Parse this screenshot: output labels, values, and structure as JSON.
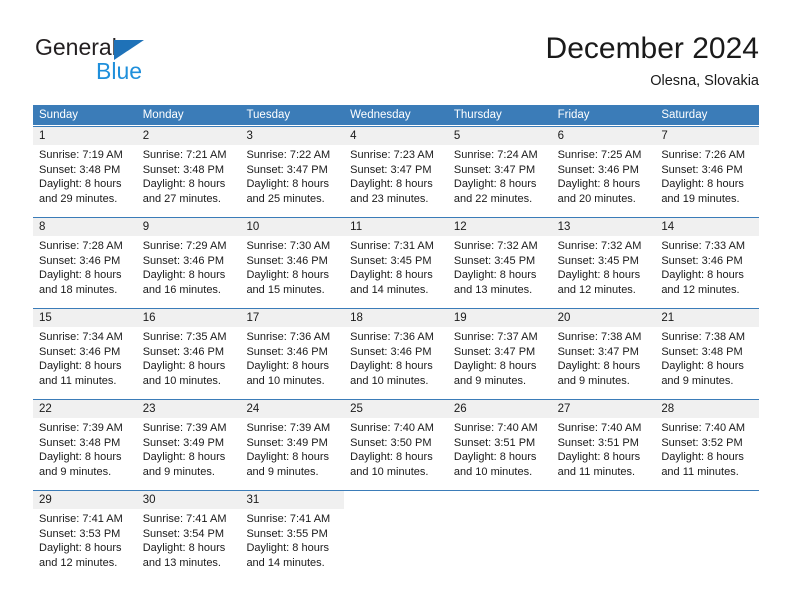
{
  "logo": {
    "word_top": "General",
    "word_bottom": "Blue",
    "triangle_color": "#1f72b8",
    "bottom_color": "#1f8fdb"
  },
  "header": {
    "title": "December 2024",
    "subtitle": "Olesna, Slovakia"
  },
  "theme": {
    "header_blue": "#3b7cb8",
    "daynum_band": "#f0f0f0",
    "text": "#1a1a1a"
  },
  "weekdays": [
    "Sunday",
    "Monday",
    "Tuesday",
    "Wednesday",
    "Thursday",
    "Friday",
    "Saturday"
  ],
  "weeks": [
    [
      {
        "day": "1",
        "sunrise": "Sunrise: 7:19 AM",
        "sunset": "Sunset: 3:48 PM",
        "daylight1": "Daylight: 8 hours",
        "daylight2": "and 29 minutes."
      },
      {
        "day": "2",
        "sunrise": "Sunrise: 7:21 AM",
        "sunset": "Sunset: 3:48 PM",
        "daylight1": "Daylight: 8 hours",
        "daylight2": "and 27 minutes."
      },
      {
        "day": "3",
        "sunrise": "Sunrise: 7:22 AM",
        "sunset": "Sunset: 3:47 PM",
        "daylight1": "Daylight: 8 hours",
        "daylight2": "and 25 minutes."
      },
      {
        "day": "4",
        "sunrise": "Sunrise: 7:23 AM",
        "sunset": "Sunset: 3:47 PM",
        "daylight1": "Daylight: 8 hours",
        "daylight2": "and 23 minutes."
      },
      {
        "day": "5",
        "sunrise": "Sunrise: 7:24 AM",
        "sunset": "Sunset: 3:47 PM",
        "daylight1": "Daylight: 8 hours",
        "daylight2": "and 22 minutes."
      },
      {
        "day": "6",
        "sunrise": "Sunrise: 7:25 AM",
        "sunset": "Sunset: 3:46 PM",
        "daylight1": "Daylight: 8 hours",
        "daylight2": "and 20 minutes."
      },
      {
        "day": "7",
        "sunrise": "Sunrise: 7:26 AM",
        "sunset": "Sunset: 3:46 PM",
        "daylight1": "Daylight: 8 hours",
        "daylight2": "and 19 minutes."
      }
    ],
    [
      {
        "day": "8",
        "sunrise": "Sunrise: 7:28 AM",
        "sunset": "Sunset: 3:46 PM",
        "daylight1": "Daylight: 8 hours",
        "daylight2": "and 18 minutes."
      },
      {
        "day": "9",
        "sunrise": "Sunrise: 7:29 AM",
        "sunset": "Sunset: 3:46 PM",
        "daylight1": "Daylight: 8 hours",
        "daylight2": "and 16 minutes."
      },
      {
        "day": "10",
        "sunrise": "Sunrise: 7:30 AM",
        "sunset": "Sunset: 3:46 PM",
        "daylight1": "Daylight: 8 hours",
        "daylight2": "and 15 minutes."
      },
      {
        "day": "11",
        "sunrise": "Sunrise: 7:31 AM",
        "sunset": "Sunset: 3:45 PM",
        "daylight1": "Daylight: 8 hours",
        "daylight2": "and 14 minutes."
      },
      {
        "day": "12",
        "sunrise": "Sunrise: 7:32 AM",
        "sunset": "Sunset: 3:45 PM",
        "daylight1": "Daylight: 8 hours",
        "daylight2": "and 13 minutes."
      },
      {
        "day": "13",
        "sunrise": "Sunrise: 7:32 AM",
        "sunset": "Sunset: 3:45 PM",
        "daylight1": "Daylight: 8 hours",
        "daylight2": "and 12 minutes."
      },
      {
        "day": "14",
        "sunrise": "Sunrise: 7:33 AM",
        "sunset": "Sunset: 3:46 PM",
        "daylight1": "Daylight: 8 hours",
        "daylight2": "and 12 minutes."
      }
    ],
    [
      {
        "day": "15",
        "sunrise": "Sunrise: 7:34 AM",
        "sunset": "Sunset: 3:46 PM",
        "daylight1": "Daylight: 8 hours",
        "daylight2": "and 11 minutes."
      },
      {
        "day": "16",
        "sunrise": "Sunrise: 7:35 AM",
        "sunset": "Sunset: 3:46 PM",
        "daylight1": "Daylight: 8 hours",
        "daylight2": "and 10 minutes."
      },
      {
        "day": "17",
        "sunrise": "Sunrise: 7:36 AM",
        "sunset": "Sunset: 3:46 PM",
        "daylight1": "Daylight: 8 hours",
        "daylight2": "and 10 minutes."
      },
      {
        "day": "18",
        "sunrise": "Sunrise: 7:36 AM",
        "sunset": "Sunset: 3:46 PM",
        "daylight1": "Daylight: 8 hours",
        "daylight2": "and 10 minutes."
      },
      {
        "day": "19",
        "sunrise": "Sunrise: 7:37 AM",
        "sunset": "Sunset: 3:47 PM",
        "daylight1": "Daylight: 8 hours",
        "daylight2": "and 9 minutes."
      },
      {
        "day": "20",
        "sunrise": "Sunrise: 7:38 AM",
        "sunset": "Sunset: 3:47 PM",
        "daylight1": "Daylight: 8 hours",
        "daylight2": "and 9 minutes."
      },
      {
        "day": "21",
        "sunrise": "Sunrise: 7:38 AM",
        "sunset": "Sunset: 3:48 PM",
        "daylight1": "Daylight: 8 hours",
        "daylight2": "and 9 minutes."
      }
    ],
    [
      {
        "day": "22",
        "sunrise": "Sunrise: 7:39 AM",
        "sunset": "Sunset: 3:48 PM",
        "daylight1": "Daylight: 8 hours",
        "daylight2": "and 9 minutes."
      },
      {
        "day": "23",
        "sunrise": "Sunrise: 7:39 AM",
        "sunset": "Sunset: 3:49 PM",
        "daylight1": "Daylight: 8 hours",
        "daylight2": "and 9 minutes."
      },
      {
        "day": "24",
        "sunrise": "Sunrise: 7:39 AM",
        "sunset": "Sunset: 3:49 PM",
        "daylight1": "Daylight: 8 hours",
        "daylight2": "and 9 minutes."
      },
      {
        "day": "25",
        "sunrise": "Sunrise: 7:40 AM",
        "sunset": "Sunset: 3:50 PM",
        "daylight1": "Daylight: 8 hours",
        "daylight2": "and 10 minutes."
      },
      {
        "day": "26",
        "sunrise": "Sunrise: 7:40 AM",
        "sunset": "Sunset: 3:51 PM",
        "daylight1": "Daylight: 8 hours",
        "daylight2": "and 10 minutes."
      },
      {
        "day": "27",
        "sunrise": "Sunrise: 7:40 AM",
        "sunset": "Sunset: 3:51 PM",
        "daylight1": "Daylight: 8 hours",
        "daylight2": "and 11 minutes."
      },
      {
        "day": "28",
        "sunrise": "Sunrise: 7:40 AM",
        "sunset": "Sunset: 3:52 PM",
        "daylight1": "Daylight: 8 hours",
        "daylight2": "and 11 minutes."
      }
    ],
    [
      {
        "day": "29",
        "sunrise": "Sunrise: 7:41 AM",
        "sunset": "Sunset: 3:53 PM",
        "daylight1": "Daylight: 8 hours",
        "daylight2": "and 12 minutes."
      },
      {
        "day": "30",
        "sunrise": "Sunrise: 7:41 AM",
        "sunset": "Sunset: 3:54 PM",
        "daylight1": "Daylight: 8 hours",
        "daylight2": "and 13 minutes."
      },
      {
        "day": "31",
        "sunrise": "Sunrise: 7:41 AM",
        "sunset": "Sunset: 3:55 PM",
        "daylight1": "Daylight: 8 hours",
        "daylight2": "and 14 minutes."
      },
      {
        "day": "",
        "sunrise": "",
        "sunset": "",
        "daylight1": "",
        "daylight2": ""
      },
      {
        "day": "",
        "sunrise": "",
        "sunset": "",
        "daylight1": "",
        "daylight2": ""
      },
      {
        "day": "",
        "sunrise": "",
        "sunset": "",
        "daylight1": "",
        "daylight2": ""
      },
      {
        "day": "",
        "sunrise": "",
        "sunset": "",
        "daylight1": "",
        "daylight2": ""
      }
    ]
  ]
}
